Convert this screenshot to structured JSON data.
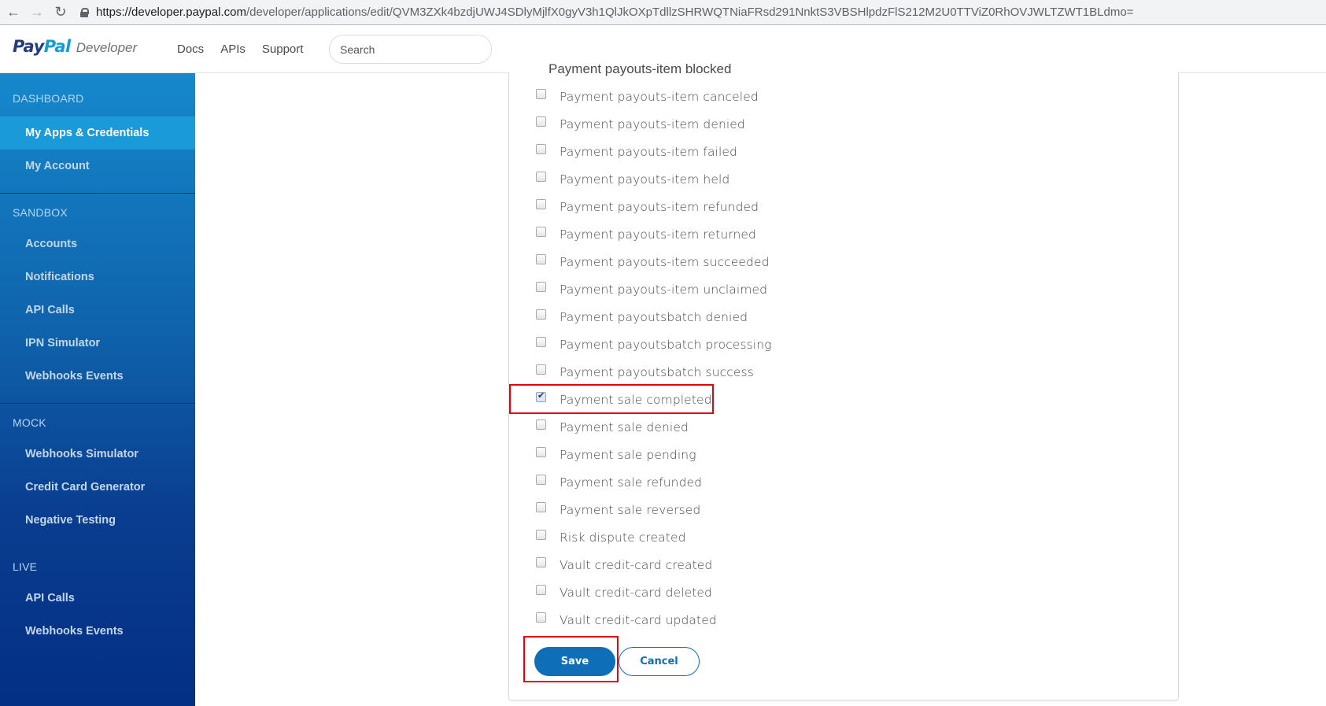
{
  "browser": {
    "url_host": "https://developer.paypal.com",
    "url_path": "/developer/applications/edit/QVM3ZXk4bzdjUWJ4SDlyMjlfX0gyV3h1QlJkOXpTdllzSHRWQTNiaFRsd291NnktS3VBSHlpdzFlS212M2U0TTViZ0RhOVJWLTZWT1BLdmo="
  },
  "header": {
    "logo_pay": "Pay",
    "logo_pal": "Pal",
    "logo_developer": "Developer",
    "links": [
      "Docs",
      "APIs",
      "Support"
    ],
    "search_placeholder": "Search"
  },
  "sidebar": {
    "sections": [
      {
        "title": "DASHBOARD",
        "items": [
          {
            "label": "My Apps & Credentials",
            "active": true
          },
          {
            "label": "My Account",
            "active": false
          }
        ]
      },
      {
        "title": "SANDBOX",
        "items": [
          {
            "label": "Accounts"
          },
          {
            "label": "Notifications"
          },
          {
            "label": "API Calls"
          },
          {
            "label": "IPN Simulator"
          },
          {
            "label": "Webhooks Events"
          }
        ]
      },
      {
        "title": "MOCK",
        "items": [
          {
            "label": "Webhooks Simulator"
          },
          {
            "label": "Credit Card Generator"
          },
          {
            "label": "Negative Testing"
          }
        ]
      },
      {
        "title": "LIVE",
        "items": [
          {
            "label": "API Calls"
          },
          {
            "label": "Webhooks Events"
          }
        ]
      }
    ]
  },
  "events": {
    "partial_row_label": "Payment payouts-item blocked",
    "items": [
      {
        "label": "Payment payouts-item canceled",
        "checked": false
      },
      {
        "label": "Payment payouts-item denied",
        "checked": false
      },
      {
        "label": "Payment payouts-item failed",
        "checked": false
      },
      {
        "label": "Payment payouts-item held",
        "checked": false
      },
      {
        "label": "Payment payouts-item refunded",
        "checked": false
      },
      {
        "label": "Payment payouts-item returned",
        "checked": false
      },
      {
        "label": "Payment payouts-item succeeded",
        "checked": false
      },
      {
        "label": "Payment payouts-item unclaimed",
        "checked": false
      },
      {
        "label": "Payment payoutsbatch denied",
        "checked": false
      },
      {
        "label": "Payment payoutsbatch processing",
        "checked": false
      },
      {
        "label": "Payment payoutsbatch success",
        "checked": false
      },
      {
        "label": "Payment sale completed",
        "checked": true
      },
      {
        "label": "Payment sale denied",
        "checked": false
      },
      {
        "label": "Payment sale pending",
        "checked": false
      },
      {
        "label": "Payment sale refunded",
        "checked": false
      },
      {
        "label": "Payment sale reversed",
        "checked": false
      },
      {
        "label": "Risk dispute created",
        "checked": false
      },
      {
        "label": "Vault credit-card created",
        "checked": false
      },
      {
        "label": "Vault credit-card deleted",
        "checked": false
      },
      {
        "label": "Vault credit-card updated",
        "checked": false
      }
    ]
  },
  "actions": {
    "save_label": "Save",
    "cancel_label": "Cancel"
  },
  "colors": {
    "highlight_red": "#e8000b",
    "primary_blue": "#0f6eb8",
    "sidebar_active": "#1b9ad9"
  }
}
